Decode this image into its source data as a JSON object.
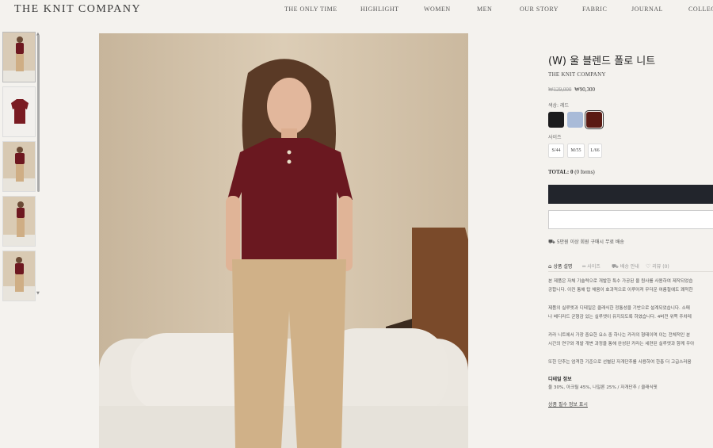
{
  "header": {
    "logo": "THE KNIT COMPANY",
    "nav": [
      "THE ONLY TIME",
      "HIGHLIGHT",
      "WOMEN",
      "MEN",
      "OUR STORY",
      "FABRIC",
      "JOURNAL",
      "COLLECT"
    ]
  },
  "product": {
    "title": "(W) 울 블렌드 폴로 니트",
    "brand": "THE KNIT COMPANY",
    "price_original": "₩129,000",
    "price_sale": "₩90,300",
    "color_label": "색상: 레드",
    "colors": [
      {
        "name": "black",
        "hex": "#1b1b1d"
      },
      {
        "name": "light-blue",
        "hex": "#a9bbd8"
      },
      {
        "name": "red",
        "hex": "#5a1a12"
      }
    ],
    "selected_color": "red",
    "size_label": "사이즈",
    "sizes": [
      "S/44",
      "M/55",
      "L/66"
    ],
    "total_label": "TOTAL:",
    "total_value": "0",
    "total_items": "(0 Items)",
    "shipping_note": "5만원 이상 회원 구매시 무료 배송"
  },
  "tabs": {
    "detail": "상품 설명",
    "size": "사이즈",
    "shipping": "배송 안내",
    "review": "리뷰 (0)"
  },
  "description": {
    "p1_line1": "본 제품은 자체 기술력으로 개발한 특수 가공된 울 원사를 사용하여 제작되었습",
    "p1_line2": "공합니다. 이컨 통해 탑 채움이 효과적으로 이루어져 무더운 여름철에도 쾌적한",
    "p2_line1": "제품의 실루엣과 디테일은 클래식한 정통성을 기반으로 설계되었습니다. 소매",
    "p2_line2": "나 베디라드 균형감 있는 실루엣이 유지되도록 하였습니다. 4버전 위쪽 주차레",
    "p3_line1": "카라 니트에서 가장 중요한 요소 중 하나는 카라의 형태이며 이는 전체적인 분",
    "p3_line2": "시간의 연구와 개발 개변 과정을 통해 완성된 카라는 세련된 실루엣과 함께 우아",
    "p4_line1": "또한 단추는 엄격한 기준으로 선별된 자개단추를 사용하여 한층 더 고급스러움",
    "detail_head": "디테일 정보",
    "detail_text": "울 30%, 아크릴 45%, 나일론 25% / 자개단추 / 클래식핏",
    "info_link": "상품 필수 정보 표시"
  },
  "icons": {
    "ship": "truck-icon",
    "tag": "tag-icon"
  }
}
